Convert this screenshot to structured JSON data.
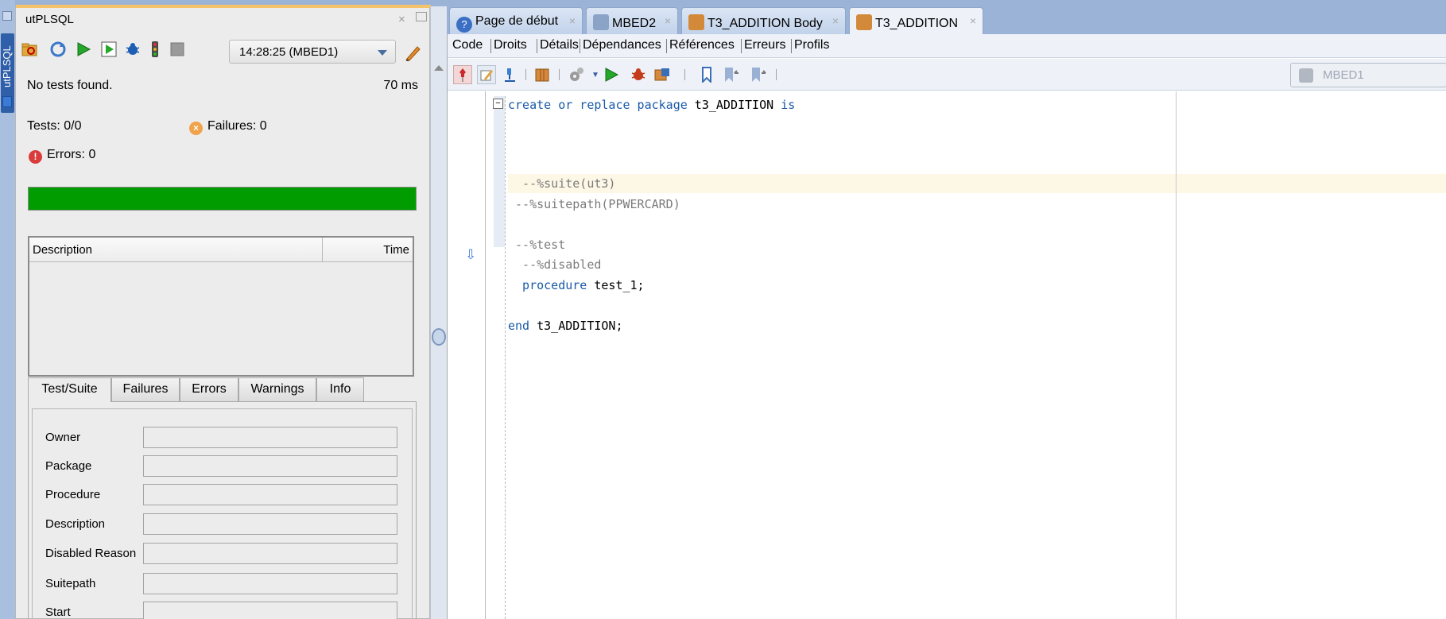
{
  "side_strip": {
    "label": "utPLSQL"
  },
  "ut_panel": {
    "title": "utPLSQL",
    "close": "×",
    "connection_select": "14:28:25 (MBED1)",
    "status": "No tests found.",
    "duration": "70 ms",
    "tests": "Tests: 0/0",
    "failures": "Failures: 0",
    "errors": "Errors: 0",
    "progress": 1.0,
    "progress_color": "#019c00",
    "table": {
      "col_description": "Description",
      "col_time": "Time"
    },
    "tabs": [
      "Test/Suite",
      "Failures",
      "Errors",
      "Warnings",
      "Info"
    ],
    "fields": [
      "Owner",
      "Package",
      "Procedure",
      "Description",
      "Disabled Reason",
      "Suitepath",
      "Start"
    ]
  },
  "editor_tabs": [
    {
      "label": "Page de début",
      "close": "×"
    },
    {
      "label": "MBED2",
      "close": "×"
    },
    {
      "label": "T3_ADDITION Body",
      "close": "×"
    },
    {
      "label": "T3_ADDITION",
      "close": "×"
    }
  ],
  "sub_tabs": [
    "Code",
    "Droits",
    "Détails",
    "Dépendances",
    "Références",
    "Erreurs",
    "Profils"
  ],
  "connection_field": "MBED1",
  "code": {
    "l1_kw1": "create or replace package",
    "l1_name": " t3_ADDITION ",
    "l1_kw2": "is",
    "l2": "  --%suite(ut3)",
    "l3": " --%suitepath(PPWERCARD)",
    "l4": " --%test",
    "l5": "  --%disabled",
    "l6_kw": "  procedure",
    "l6_rest": " test_1;",
    "l7_kw": "end",
    "l7_rest": " t3_ADDITION;"
  }
}
